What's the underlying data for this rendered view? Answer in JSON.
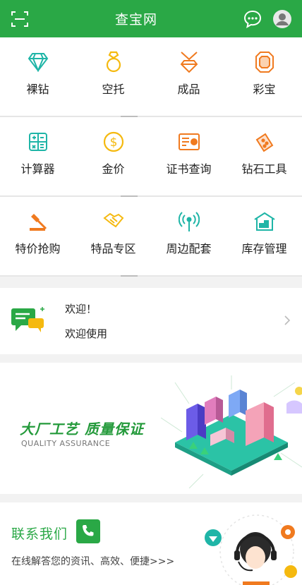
{
  "header": {
    "title": "查宝网"
  },
  "grid": [
    [
      {
        "label": "裸钻",
        "icon": "diamond-icon"
      },
      {
        "label": "空托",
        "icon": "ring-icon"
      },
      {
        "label": "成品",
        "icon": "pendant-icon"
      },
      {
        "label": "彩宝",
        "icon": "gemstone-icon"
      }
    ],
    [
      {
        "label": "计算器",
        "icon": "calculator-icon"
      },
      {
        "label": "金价",
        "icon": "dollar-coin-icon"
      },
      {
        "label": "证书查询",
        "icon": "certificate-icon"
      },
      {
        "label": "钻石工具",
        "icon": "tools-icon"
      }
    ],
    [
      {
        "label": "特价抢购",
        "icon": "auction-hammer-icon"
      },
      {
        "label": "特品专区",
        "icon": "handshake-icon"
      },
      {
        "label": "周边配套",
        "icon": "broadcast-icon"
      },
      {
        "label": "库存管理",
        "icon": "warehouse-icon"
      }
    ]
  ],
  "welcome": {
    "line1": "欢迎！",
    "line2": "欢迎使用"
  },
  "banner": {
    "headline": "大厂工艺 质量保证",
    "subline": "QUALITY ASSURANCE"
  },
  "contact": {
    "title": "联系我们",
    "subtitle": "在线解答您的资讯、高效、便捷>>>"
  },
  "colors": {
    "brand": "#2aa846",
    "teal": "#1fb5a7",
    "orange": "#f07a1f",
    "yellow": "#f5b90f"
  }
}
